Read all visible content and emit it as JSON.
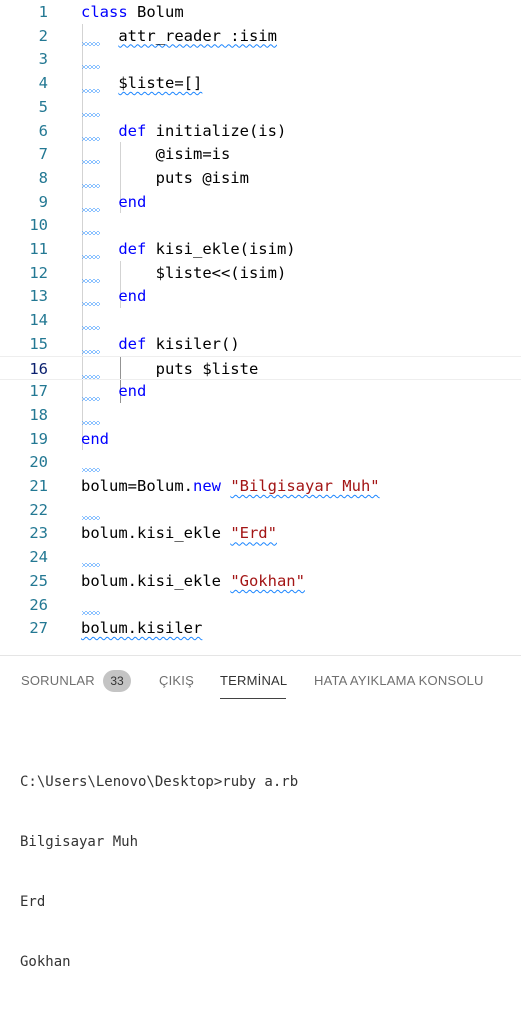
{
  "editor": {
    "lines": [
      {
        "n": "1",
        "t": [
          {
            "c": "kw",
            "s": "class"
          },
          {
            "s": " Bolum"
          }
        ]
      },
      {
        "n": "2",
        "t": [
          {
            "s": "    "
          },
          {
            "c": "squig",
            "s": "attr_reader :isim"
          }
        ]
      },
      {
        "n": "3",
        "t": []
      },
      {
        "n": "4",
        "t": [
          {
            "s": "    "
          },
          {
            "c": "squig",
            "s": "$liste=[]"
          }
        ]
      },
      {
        "n": "5",
        "t": []
      },
      {
        "n": "6",
        "t": [
          {
            "s": "    "
          },
          {
            "c": "kw",
            "s": "def"
          },
          {
            "s": " initialize(is)"
          }
        ]
      },
      {
        "n": "7",
        "t": [
          {
            "s": "        @isim=is"
          }
        ]
      },
      {
        "n": "8",
        "t": [
          {
            "s": "        puts @isim"
          }
        ]
      },
      {
        "n": "9",
        "t": [
          {
            "s": "    "
          },
          {
            "c": "kw",
            "s": "end"
          }
        ]
      },
      {
        "n": "10",
        "t": []
      },
      {
        "n": "11",
        "t": [
          {
            "s": "    "
          },
          {
            "c": "kw",
            "s": "def"
          },
          {
            "s": " kisi_ekle(isim)"
          }
        ]
      },
      {
        "n": "12",
        "t": [
          {
            "s": "        $liste<<(isim)"
          }
        ]
      },
      {
        "n": "13",
        "t": [
          {
            "s": "    "
          },
          {
            "c": "kw",
            "s": "end"
          }
        ]
      },
      {
        "n": "14",
        "t": []
      },
      {
        "n": "15",
        "t": [
          {
            "s": "    "
          },
          {
            "c": "kw",
            "s": "def"
          },
          {
            "s": " kisiler()"
          }
        ]
      },
      {
        "n": "16",
        "t": [
          {
            "s": "        puts $liste"
          }
        ]
      },
      {
        "n": "17",
        "t": [
          {
            "s": "    "
          },
          {
            "c": "kw",
            "s": "end"
          }
        ]
      },
      {
        "n": "18",
        "t": []
      },
      {
        "n": "19",
        "t": [
          {
            "c": "kw",
            "s": "end"
          }
        ]
      },
      {
        "n": "20",
        "t": []
      },
      {
        "n": "21",
        "t": [
          {
            "s": "bolum=Bolum."
          },
          {
            "c": "kw",
            "s": "new"
          },
          {
            "s": " "
          },
          {
            "c": "str squig",
            "s": "\"Bilgisayar Muh\""
          }
        ]
      },
      {
        "n": "22",
        "t": []
      },
      {
        "n": "23",
        "t": [
          {
            "s": "bolum.kisi_ekle "
          },
          {
            "c": "str squig",
            "s": "\"Erd\""
          }
        ]
      },
      {
        "n": "24",
        "t": []
      },
      {
        "n": "25",
        "t": [
          {
            "s": "bolum.kisi_ekle "
          },
          {
            "c": "str squig",
            "s": "\"Gokhan\""
          }
        ]
      },
      {
        "n": "26",
        "t": []
      },
      {
        "n": "27",
        "t": [
          {
            "c": "squig",
            "s": "bolum.kisiler"
          }
        ]
      }
    ],
    "active_line": "16"
  },
  "panel": {
    "tabs": {
      "problems": "SORUNLAR",
      "problems_count": "33",
      "output": "ÇIKIŞ",
      "terminal": "TERMİNAL",
      "debug_console": "HATA AYIKLAMA KONSOLU"
    },
    "terminal_lines": [
      "C:\\Users\\Lenovo\\Desktop>ruby a.rb",
      "Bilgisayar Muh",
      "Erd",
      "Gokhan"
    ]
  },
  "colors": {
    "keyword": "#0000ff",
    "string": "#a31515",
    "line_number": "#237893",
    "squiggle": "#1a85ff"
  }
}
